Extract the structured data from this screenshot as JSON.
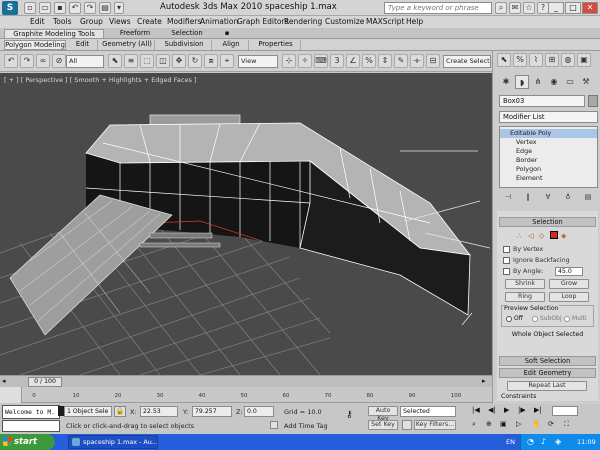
{
  "window": {
    "app_logo": "S",
    "title": "Autodesk 3ds Max  2010     spaceship 1.max",
    "search_placeholder": "Type a keyword or phrase"
  },
  "menu": [
    "Edit",
    "Tools",
    "Group",
    "Views",
    "Create",
    "Modifiers",
    "Animation",
    "Graph Editors",
    "Rendering",
    "Customize",
    "MAXScript",
    "Help"
  ],
  "ribbon": {
    "tabs": [
      "Graphite Modeling Tools",
      "Freeform",
      "Selection"
    ],
    "subtabs": [
      "Polygon Modeling",
      "Edit",
      "Geometry (All)",
      "Subdivision",
      "Align",
      "Properties"
    ]
  },
  "toolbar": {
    "filter_dropdown": "All",
    "coord_dropdown": "View",
    "selection_set": "Create Selection Se"
  },
  "viewport": {
    "label": "[ + ] [ Perspective ] [ Smooth + Highlights + Edged Faces ]"
  },
  "command_panel": {
    "object_name": "Box03",
    "object_color": "#aaa9a0",
    "modifier_list": "Modifier List",
    "stack": [
      "Editable Poly",
      "Vertex",
      "Edge",
      "Border",
      "Polygon",
      "Element"
    ],
    "selection_rollout": "Selection",
    "by_vertex": "By Vertex",
    "ignore_backfacing": "Ignore Backfacing",
    "by_angle": "By Angle:",
    "by_angle_value": "45.0",
    "shrink": "Shrink",
    "grow": "Grow",
    "ring": "Ring",
    "loop": "Loop",
    "preview_selection": "Preview Selection",
    "preview_options": [
      "Off",
      "SubObj",
      "Multi"
    ],
    "selection_status": "Whole Object Selected",
    "soft_selection": "Soft Selection",
    "edit_geometry": "Edit Geometry",
    "repeat_last": "Repeat Last",
    "constraints": "Constraints"
  },
  "timeline": {
    "slider": "0 / 100",
    "ticks": [
      "0",
      "10",
      "20",
      "30",
      "40",
      "50",
      "60",
      "70",
      "80",
      "90",
      "100"
    ]
  },
  "status": {
    "maxscript_text": "Welcome to M.",
    "object_count": "1 Object Sele",
    "x_label": "X:",
    "x_value": "22.53",
    "y_label": "Y:",
    "y_value": "79.257",
    "z_label": "Z:",
    "z_value": "0.0",
    "grid": "Grid = 10.0",
    "prompt": "Click or click-and-drag to select objects",
    "add_time_tag": "Add Time Tag",
    "auto_key": "Auto Key",
    "set_key": "Set Key",
    "key_mode": "Selected",
    "key_filters": "Key Filters..."
  },
  "taskbar": {
    "start": "start",
    "task": "spaceship 1.max - Au...",
    "lang": "EN",
    "clock": "11:09"
  }
}
